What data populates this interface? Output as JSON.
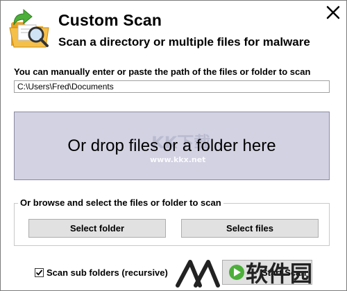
{
  "dialog": {
    "title": "Custom Scan",
    "subtitle": "Scan a directory or multiple files for malware"
  },
  "path": {
    "label": "You can manually enter or paste the path of the files or folder to scan",
    "value": "C:\\Users\\Fred\\Documents"
  },
  "drop_zone": {
    "text": "Or drop files or a folder here",
    "watermark_logo_text": "KK下载",
    "watermark_url": "www.kkx.net"
  },
  "browse": {
    "legend": "Or browse and select the files or folder to scan",
    "select_folder_label": "Select folder",
    "select_files_label": "Select files"
  },
  "options": {
    "scan_subfolders_label": "Scan sub folders (recursive)",
    "scan_subfolders_checked": true
  },
  "start_button": {
    "label": "Start Scan"
  },
  "corner_watermark": {
    "text": "软件园"
  },
  "colors": {
    "drop_zone_bg": "#d2d2e3",
    "button_bg": "#e1e1e1",
    "folder_icon": "#f2b632",
    "arrow_icon": "#4caf3a"
  },
  "icons": [
    "folder-search-icon",
    "close-icon",
    "checkmark-icon",
    "scan-icon"
  ]
}
